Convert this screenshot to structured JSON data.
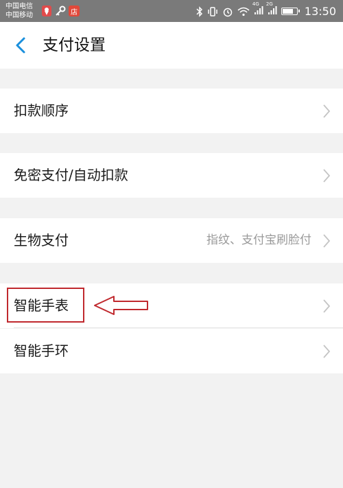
{
  "status_bar": {
    "carrier_1": "中国电信",
    "carrier_2": "中国移动",
    "app_icon_store": "店",
    "network_4g": "4G",
    "network_2g": "2G",
    "time": "13:50",
    "battery_level_percent": 80,
    "icons": [
      "location-pin-icon",
      "key-icon",
      "store-app-icon",
      "bluetooth-icon",
      "vibrate-icon",
      "alarm-icon",
      "wifi-icon",
      "signal-icon",
      "battery-icon"
    ]
  },
  "header": {
    "title": "支付设置",
    "back_icon": "chevron-left-icon"
  },
  "rows": [
    {
      "label": "扣款顺序",
      "value": ""
    },
    {
      "label": "免密支付/自动扣款",
      "value": ""
    },
    {
      "label": "生物支付",
      "value": "指纹、支付宝刷脸付"
    },
    {
      "label": "智能手表",
      "value": ""
    },
    {
      "label": "智能手环",
      "value": ""
    }
  ],
  "colors": {
    "accent": "#1a8fdc",
    "annotation": "#c0282d",
    "background": "#f2f2f2",
    "row_bg": "#ffffff",
    "status_bar_bg": "#7a7a7a"
  }
}
